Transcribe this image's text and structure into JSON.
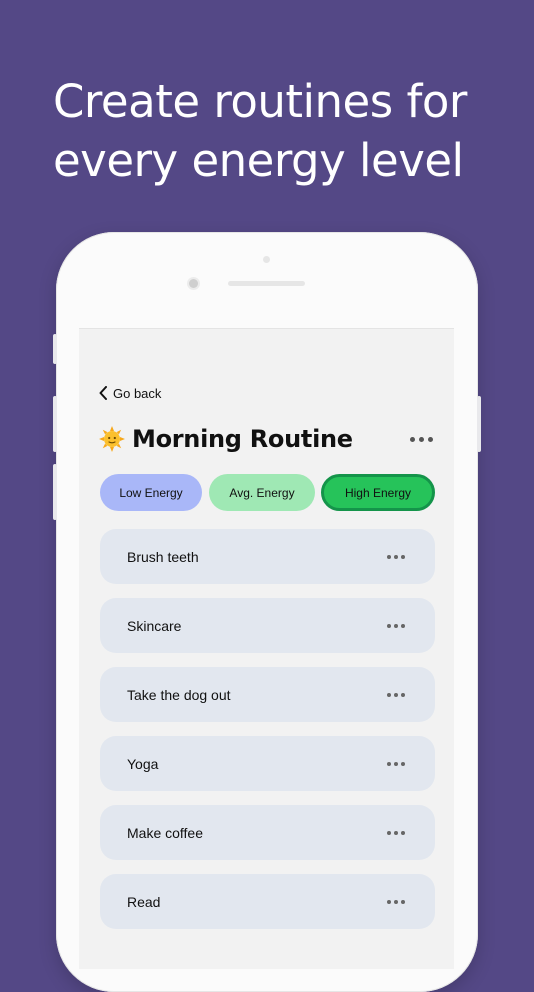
{
  "headline": "Create routines for every energy level",
  "screen": {
    "back_label": "Go back",
    "routine": {
      "icon": "sun-face-icon",
      "title": "Morning Routine"
    },
    "energy_filters": [
      {
        "label": "Low Energy",
        "color": "#a9b7f8",
        "selected": false
      },
      {
        "label": "Avg. Energy",
        "color": "#9fe8b4",
        "selected": false
      },
      {
        "label": "High Energy",
        "color": "#26c35a",
        "selected": true
      }
    ],
    "tasks": [
      {
        "label": "Brush teeth"
      },
      {
        "label": "Skincare"
      },
      {
        "label": "Take the dog out"
      },
      {
        "label": "Yoga"
      },
      {
        "label": "Make coffee"
      },
      {
        "label": "Read"
      }
    ]
  },
  "colors": {
    "background": "#544886",
    "task_card": "#e2e7ef",
    "screen_bg": "#f2f2f2"
  }
}
